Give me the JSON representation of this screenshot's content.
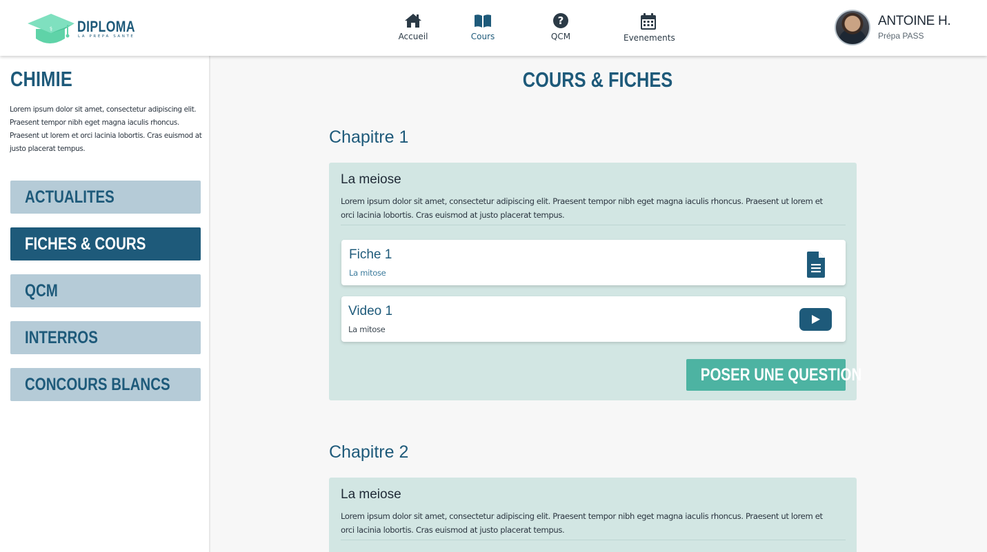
{
  "logo": {
    "title": "DIPLOMA",
    "subtitle": "LA PREPA SANTE"
  },
  "nav": [
    {
      "label": "Accueil",
      "icon": "home-icon"
    },
    {
      "label": "Cours",
      "icon": "book-icon",
      "active": true
    },
    {
      "label": "QCM",
      "icon": "question-circle-icon"
    },
    {
      "label": "Evenements",
      "icon": "calendar-icon"
    }
  ],
  "user": {
    "name": "ANTOINE H.",
    "subtitle": "Prépa PASS"
  },
  "sidebar": {
    "title": "CHIMIE",
    "description": "Lorem ipsum dolor sit amet, consectetur adipiscing elit. Praesent tempor nibh eget magna iaculis rhoncus. Praesent ut lorem et orci lacinia lobortis. Cras euismod at justo placerat tempus.",
    "items": [
      {
        "label": "ACTUALITES"
      },
      {
        "label": "FICHES & COURS",
        "active": true
      },
      {
        "label": "QCM"
      },
      {
        "label": "INTERROS"
      },
      {
        "label": "CONCOURS BLANCS"
      }
    ]
  },
  "main": {
    "title": "COURS & FICHES",
    "chapters": [
      {
        "title": "Chapitre 1",
        "card": {
          "title": "La meiose",
          "description": "Lorem ipsum dolor sit amet, consectetur adipiscing elit. Praesent tempor nibh eget magna iaculis rhoncus. Praesent ut lorem et orci lacinia lobortis. Cras euismod at justo placerat tempus.",
          "resources": [
            {
              "title": "Fiche 1",
              "subtitle": "La mitose",
              "icon": "document-icon"
            },
            {
              "title": "Video 1",
              "subtitle": "La mitose",
              "icon": "video-play-icon"
            }
          ],
          "button": "POSER UNE QUESTION"
        }
      },
      {
        "title": "Chapitre 2",
        "card": {
          "title": "La meiose",
          "description": "Lorem ipsum dolor sit amet, consectetur adipiscing elit. Praesent tempor nibh eget magna iaculis rhoncus. Praesent ut lorem et orci lacinia lobortis. Cras euismod at justo placerat tempus."
        }
      }
    ]
  },
  "colors": {
    "primary": "#1e5a7a",
    "accent": "#4db3a2",
    "card_bg": "#d2e6e3",
    "sidebar_item": "#b5cbd7",
    "logo_green": "#5fd3a8"
  }
}
